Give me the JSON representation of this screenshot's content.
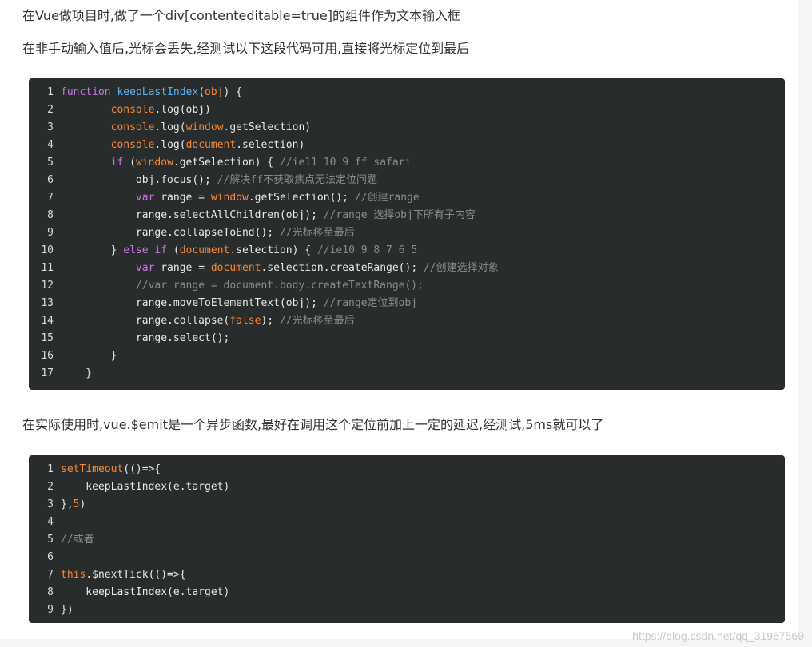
{
  "paragraphs": {
    "p1": "在Vue做项目时,做了一个div[contenteditable=true]的组件作为文本输入框",
    "p2": "在非手动输入值后,光标会丢失,经测试以下这段代码可用,直接将光标定位到最后",
    "p3": "在实际使用时,vue.$emit是一个异步函数,最好在调用这个定位前加上一定的延迟,经测试,5ms就可以了"
  },
  "code1": {
    "lines": [
      [
        [
          "function ",
          "kw"
        ],
        [
          "keepLastIndex",
          "fn"
        ],
        [
          "(",
          ""
        ],
        [
          "obj",
          "or"
        ],
        [
          ") {",
          ""
        ]
      ],
      [
        [
          "        ",
          ""
        ],
        [
          "console",
          "or"
        ],
        [
          ".log(obj)",
          ""
        ]
      ],
      [
        [
          "        ",
          ""
        ],
        [
          "console",
          "or"
        ],
        [
          ".log(",
          ""
        ],
        [
          "window",
          "or"
        ],
        [
          ".getSelection)",
          ""
        ]
      ],
      [
        [
          "        ",
          ""
        ],
        [
          "console",
          "or"
        ],
        [
          ".log(",
          ""
        ],
        [
          "document",
          "or"
        ],
        [
          ".selection)",
          ""
        ]
      ],
      [
        [
          "        ",
          ""
        ],
        [
          "if",
          "kw"
        ],
        [
          " (",
          ""
        ],
        [
          "window",
          "or"
        ],
        [
          ".getSelection) { ",
          ""
        ],
        [
          "//ie11 10 9 ff safari",
          "cm"
        ]
      ],
      [
        [
          "            obj.focus(); ",
          ""
        ],
        [
          "//解决ff不获取焦点无法定位问题",
          "cm"
        ]
      ],
      [
        [
          "            ",
          ""
        ],
        [
          "var",
          "kw"
        ],
        [
          " range = ",
          ""
        ],
        [
          "window",
          "or"
        ],
        [
          ".getSelection(); ",
          ""
        ],
        [
          "//创建range",
          "cm"
        ]
      ],
      [
        [
          "            range.selectAllChildren(obj); ",
          ""
        ],
        [
          "//range 选择obj下所有子内容",
          "cm"
        ]
      ],
      [
        [
          "            range.collapseToEnd(); ",
          ""
        ],
        [
          "//光标移至最后",
          "cm"
        ]
      ],
      [
        [
          "        } ",
          ""
        ],
        [
          "else if",
          "kw"
        ],
        [
          " (",
          ""
        ],
        [
          "document",
          "or"
        ],
        [
          ".selection) { ",
          ""
        ],
        [
          "//ie10 9 8 7 6 5",
          "cm"
        ]
      ],
      [
        [
          "            ",
          ""
        ],
        [
          "var",
          "kw"
        ],
        [
          " range = ",
          ""
        ],
        [
          "document",
          "or"
        ],
        [
          ".selection.createRange(); ",
          ""
        ],
        [
          "//创建选择对象",
          "cm"
        ]
      ],
      [
        [
          "            ",
          ""
        ],
        [
          "//var range = document.body.createTextRange();",
          "cm"
        ]
      ],
      [
        [
          "            range.moveToElementText(obj); ",
          ""
        ],
        [
          "//range定位到obj",
          "cm"
        ]
      ],
      [
        [
          "            range.collapse(",
          ""
        ],
        [
          "false",
          "or"
        ],
        [
          "); ",
          ""
        ],
        [
          "//光标移至最后",
          "cm"
        ]
      ],
      [
        [
          "            range.select();",
          ""
        ]
      ],
      [
        [
          "        }",
          ""
        ]
      ],
      [
        [
          "    }",
          ""
        ]
      ]
    ]
  },
  "code2": {
    "lines": [
      [
        [
          "setTimeout",
          "or"
        ],
        [
          "(()=>{",
          ""
        ]
      ],
      [
        [
          "    keepLastIndex(e.target)",
          ""
        ]
      ],
      [
        [
          "},",
          ""
        ],
        [
          "5",
          "or"
        ],
        [
          ")",
          ""
        ]
      ],
      [
        [
          "",
          ""
        ]
      ],
      [
        [
          "//或者",
          "cm"
        ]
      ],
      [
        [
          "",
          ""
        ]
      ],
      [
        [
          "this",
          "or"
        ],
        [
          ".$nextTick(()=>{",
          ""
        ]
      ],
      [
        [
          "    keepLastIndex(e.target)",
          ""
        ]
      ],
      [
        [
          "})",
          ""
        ]
      ]
    ]
  },
  "watermark": "https://blog.csdn.net/qq_31967569"
}
